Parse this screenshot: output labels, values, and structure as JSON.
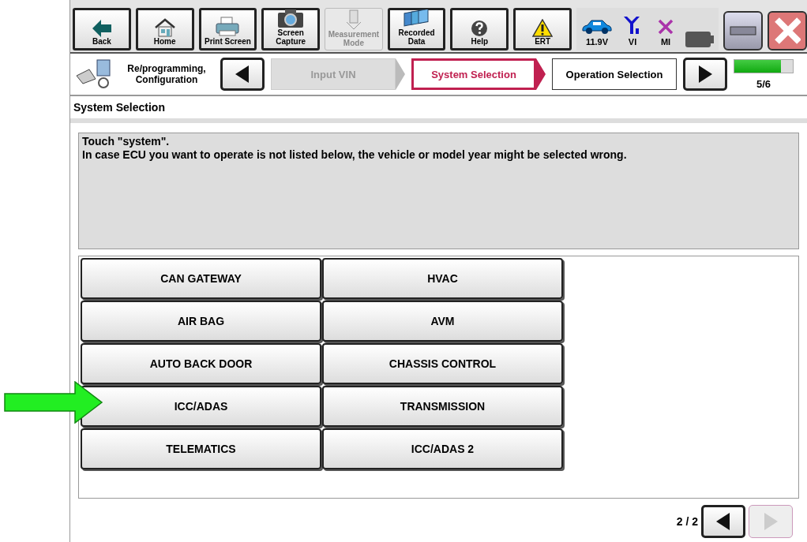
{
  "toolbar": {
    "buttons": [
      {
        "kind": "back",
        "label": "Back",
        "disabled": false
      },
      {
        "kind": "home",
        "label": "Home",
        "disabled": false
      },
      {
        "kind": "print",
        "label": "Print Screen",
        "disabled": false
      },
      {
        "kind": "camera",
        "label": "Screen\nCapture",
        "disabled": false
      },
      {
        "kind": "meter",
        "label": "Measurement\nMode",
        "disabled": true
      },
      {
        "kind": "folders",
        "label": "Recorded\nData",
        "disabled": false
      },
      {
        "kind": "help",
        "label": "Help",
        "disabled": false
      },
      {
        "kind": "warning",
        "label": "ERT",
        "disabled": false
      }
    ],
    "status": [
      {
        "kind": "car",
        "label": "11.9V"
      },
      {
        "kind": "antenna",
        "label": "VI"
      },
      {
        "kind": "cross",
        "label": "MI"
      },
      {
        "kind": "battery"
      }
    ]
  },
  "breadcrumb": {
    "mode": "Re/programming,\nConfiguration",
    "steps": [
      {
        "label": "Input VIN",
        "selected": false,
        "disabled": true
      },
      {
        "label": "System Selection",
        "selected": true,
        "disabled": false
      },
      {
        "label": "Operation Selection",
        "selected": false,
        "disabled": false
      }
    ],
    "progress": {
      "level": 0.8,
      "label": "5/6"
    }
  },
  "page_title": "System Selection",
  "message": "Touch \"system\".\nIn case ECU you want to operate is not listed below, the vehicle or model year might be selected wrong.",
  "systems": [
    "CAN GATEWAY",
    "HVAC",
    "AIR BAG",
    "AVM",
    "AUTO BACK DOOR",
    "CHASSIS CONTROL",
    "ICC/ADAS",
    "TRANSMISSION",
    "TELEMATICS",
    "ICC/ADAS 2"
  ],
  "pager": {
    "label": "2 / 2",
    "prev_disabled": false,
    "next_disabled": true
  }
}
